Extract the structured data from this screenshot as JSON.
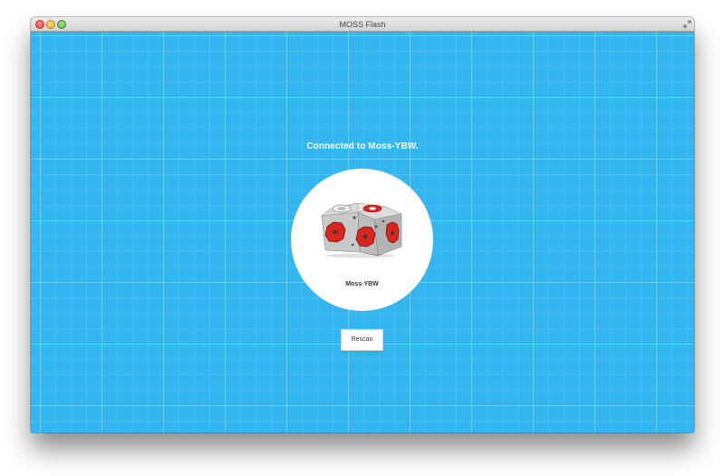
{
  "window": {
    "title": "MOSS Flash",
    "controls": [
      "close-icon",
      "minimize-icon",
      "zoom-icon",
      "fullscreen-icon"
    ]
  },
  "main": {
    "status_heading": "Connected to Moss-YBW.",
    "device": {
      "name": "Moss-YBW",
      "icon": "moss-robot-cube-icon"
    },
    "rescan_label": "Rescan"
  },
  "colors": {
    "background": "#33b6ef",
    "card": "#ffffff",
    "accent_red": "#d8261c"
  }
}
